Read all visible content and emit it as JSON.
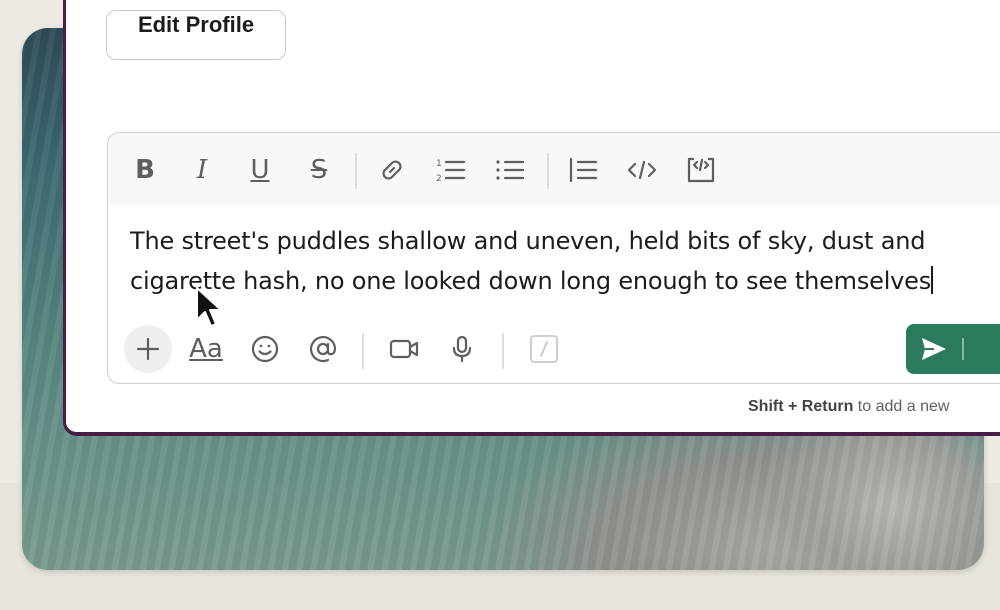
{
  "profile": {
    "edit_button_label": "Edit Profile"
  },
  "toolbar": {
    "icons": [
      "bold-icon",
      "italic-icon",
      "underline-icon",
      "strikethrough-icon",
      "link-icon",
      "ordered-list-icon",
      "bulleted-list-icon",
      "blockquote-icon",
      "code-icon",
      "code-block-icon"
    ]
  },
  "composer": {
    "message_text": "The street's puddles shallow and uneven, held bits of sky, dust and cigarette hash, no one looked down long enough to see themselves",
    "bottom_icons": [
      "plus-icon",
      "formatting-icon",
      "emoji-icon",
      "mention-icon",
      "video-icon",
      "microphone-icon",
      "slash-command-icon"
    ],
    "formatting_label": "Aa"
  },
  "send": {
    "accent_color": "#2b7a5b"
  },
  "hint": {
    "keys": "Shift + Return",
    "text": "to add a new"
  },
  "colors": {
    "window_border": "#4a1d47"
  }
}
